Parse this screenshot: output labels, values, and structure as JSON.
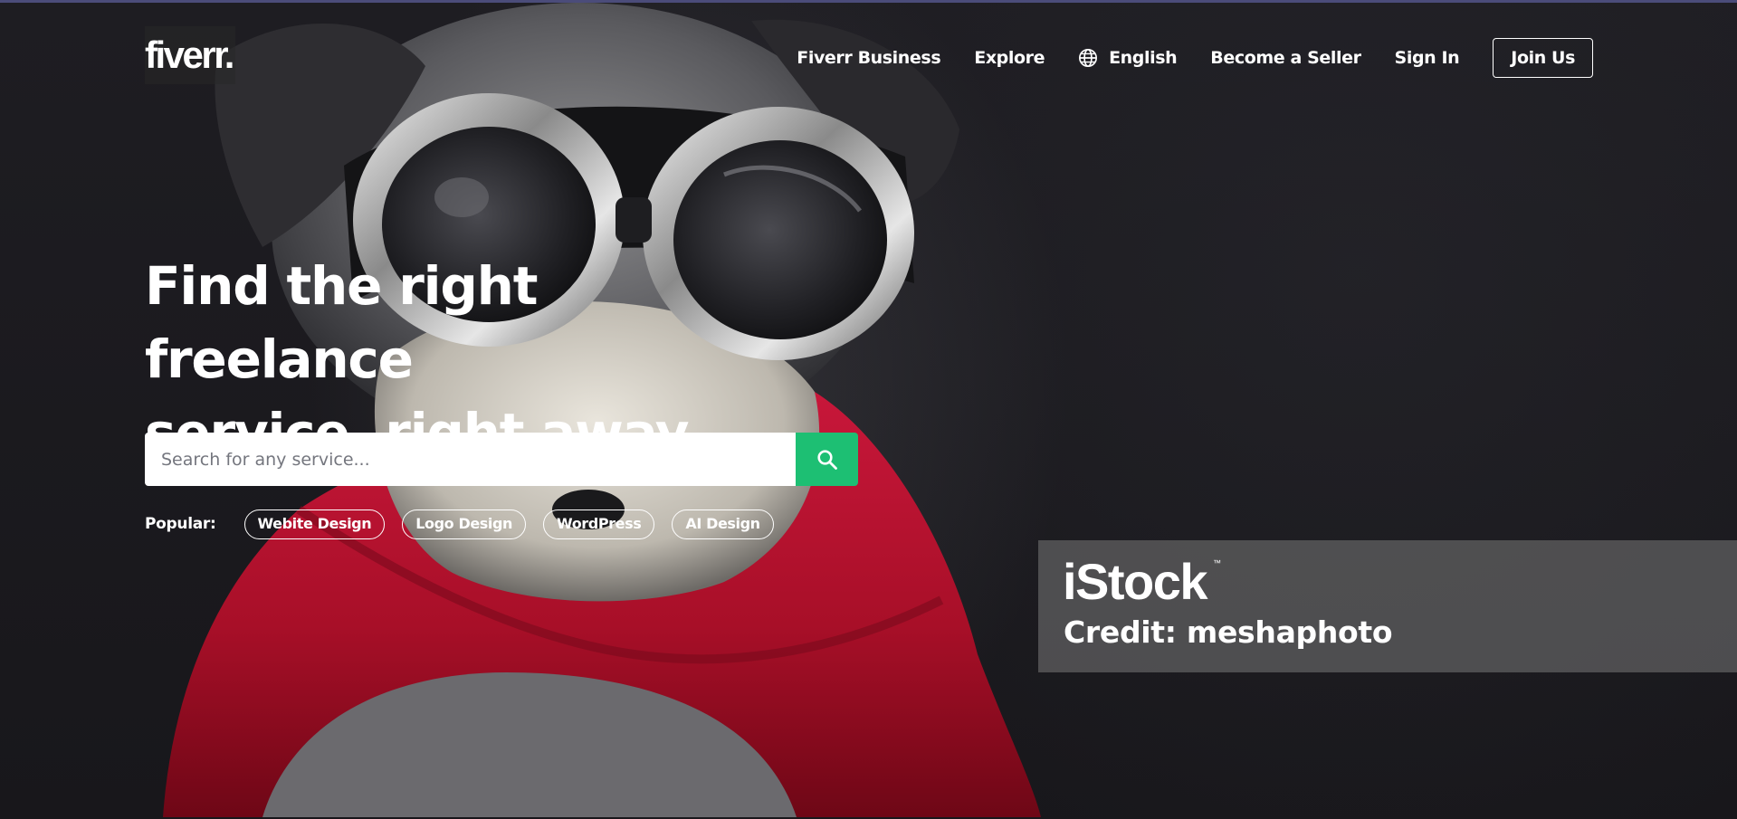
{
  "header": {
    "logo_text": "fiverr",
    "logo_dot": ".",
    "nav": {
      "business": "Fiverr Business",
      "explore": "Explore",
      "language": "English",
      "become_seller": "Become a Seller",
      "sign_in": "Sign In",
      "join": "Join Us"
    }
  },
  "hero": {
    "headline_line1": "Find the right freelance",
    "headline_line2": "service, right away",
    "search": {
      "placeholder": "Search for any service..."
    },
    "popular": {
      "label": "Popular:",
      "tags": [
        "Webite Design",
        "Logo Design",
        "WordPress",
        "AI Design"
      ]
    }
  },
  "watermark": {
    "brand": "iStock",
    "tm": "™",
    "credit": "Credit: meshaphoto"
  },
  "icons": {
    "globe": "globe-icon",
    "search": "search-icon"
  },
  "colors": {
    "background": "#1b1a1e",
    "accent_green": "#1dbf73",
    "cape_red": "#b3132b",
    "text": "#ffffff",
    "top_strip": "#4b4c7a"
  }
}
